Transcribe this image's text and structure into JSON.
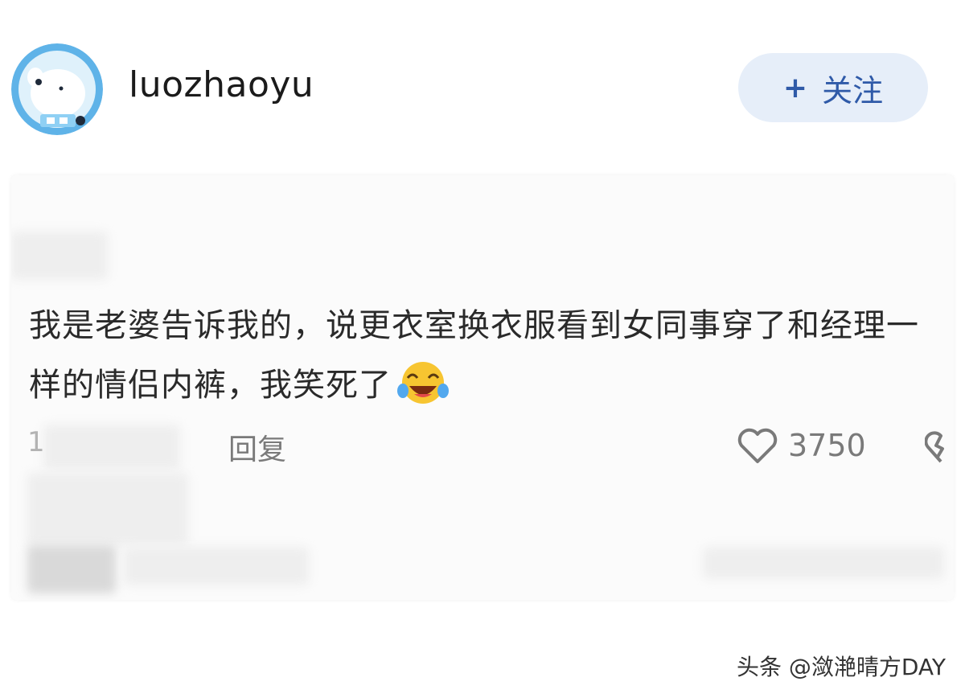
{
  "header": {
    "username": "luozhaoyu",
    "follow_button": {
      "icon": "+",
      "label": "关注"
    }
  },
  "avatar": {
    "icon": "polar-bear-astronaut-avatar",
    "bg_color": "#5fb3e8"
  },
  "comment": {
    "text": "我是老婆告诉我的，说更衣室换衣服看到女同事穿了和经理一样的情侣内裤，我笑死了",
    "emoji": "laughing-tears-emoji",
    "time_visible": "1",
    "reply_label": "回复",
    "like_count": "3750"
  },
  "colors": {
    "accent": "#2f5aa8",
    "follow_bg": "#e6eef9",
    "text": "#2a2a2a",
    "meta": "#7a7a7a"
  },
  "watermark": "头条 @潋滟晴方DAY"
}
